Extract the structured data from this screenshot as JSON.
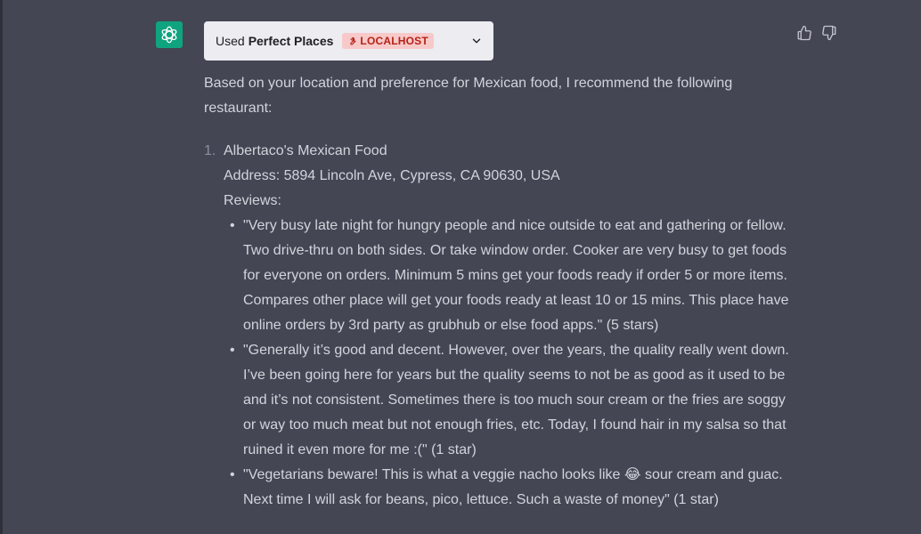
{
  "plugin": {
    "used_label": "Used",
    "name": "Perfect Places",
    "badge": "LOCALHOST"
  },
  "message": {
    "intro": "Based on your location and preference for Mexican food, I recommend the following restaurant:",
    "restaurants": [
      {
        "number": "1.",
        "name": "Albertaco's Mexican Food",
        "address": "Address: 5894 Lincoln Ave, Cypress, CA 90630, USA",
        "reviews_label": "Reviews:",
        "reviews": [
          "\"Very busy late night for hungry people and nice outside to eat and gathering or fellow. Two drive-thru on both sides. Or take window order. Cooker are very busy to get foods for everyone on orders. Minimum 5 mins get your foods ready if order 5 or more items. Compares other place will get your foods ready at least 10 or 15 mins. This place have online orders by 3rd party as grubhub or else food apps.\" (5 stars)",
          "\"Generally it’s good and decent. However, over the years, the quality really went down. I’ve been going here for years but the quality seems to not be as good as it used to be and it’s not consistent. Sometimes there is too much sour cream or the fries are soggy or way too much meat but not enough fries, etc. Today, I found hair in my salsa so that ruined it even more for me :(\" (1 star)",
          "\"Vegetarians beware! This is what a veggie nacho looks like 😂 sour cream and guac. Next time I will ask for beans, pico, lettuce. Such a waste of money\" (1 star)"
        ]
      }
    ]
  },
  "icons": {
    "avatar": "openai-logo-icon",
    "badge": "wrench-icon",
    "expand": "chevron-down-icon",
    "like": "thumbs-up-icon",
    "dislike": "thumbs-down-icon"
  },
  "colors": {
    "background": "#444654",
    "avatar": "#10a37f",
    "pill": "#ececf1",
    "badge_bg": "#f8c9c9",
    "badge_text": "#b42318",
    "text": "#d1d5db"
  }
}
